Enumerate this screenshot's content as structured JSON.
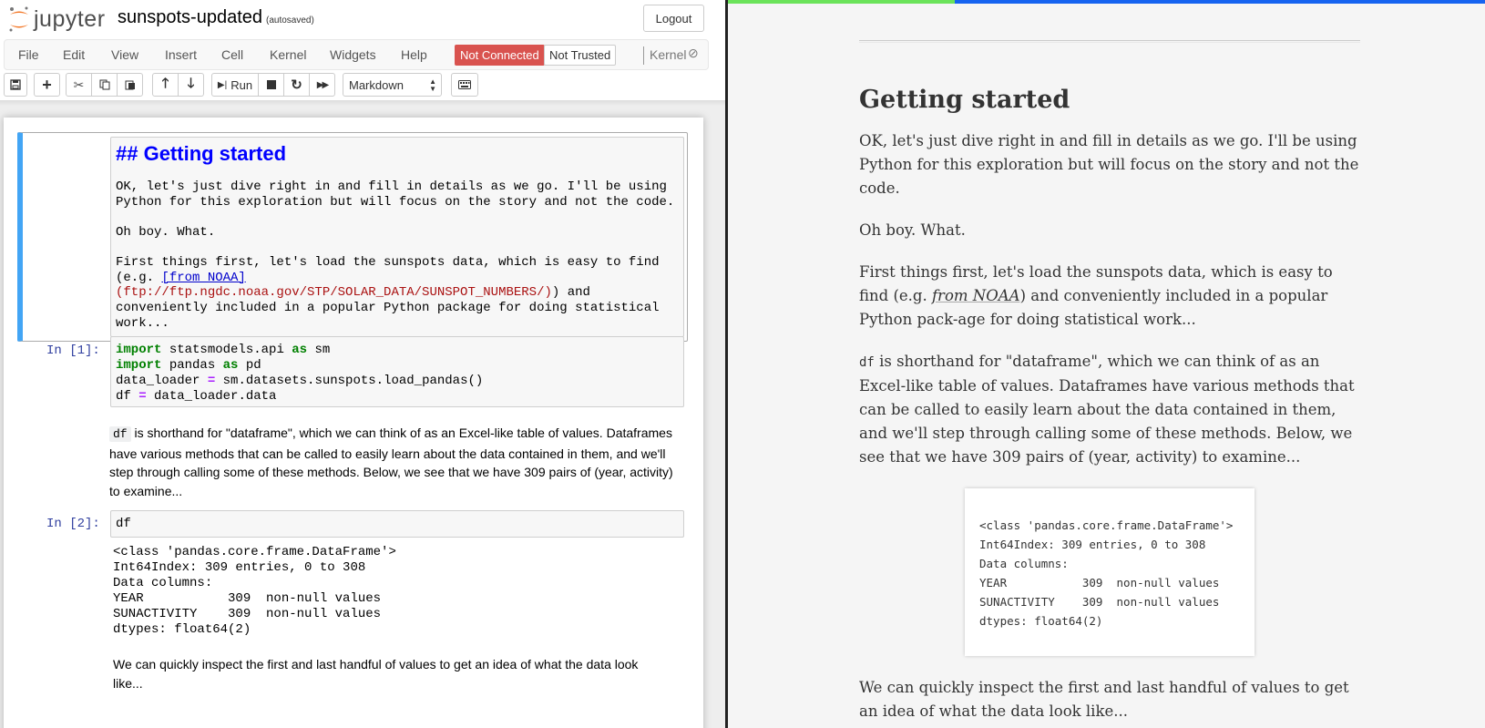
{
  "notebook": {
    "logo_text": "jupyter",
    "title": "sunspots-updated",
    "autosave": "(autosaved)",
    "logout_label": "Logout",
    "menu": [
      "File",
      "Edit",
      "View",
      "Insert",
      "Cell",
      "Kernel",
      "Widgets",
      "Help"
    ],
    "status_not_connected": "Not Connected",
    "status_not_trusted": "Not Trusted",
    "kernel_label": "Kernel",
    "toolbar": {
      "run_label": "Run",
      "cell_type": "Markdown"
    },
    "cells": {
      "md1": {
        "heading": "## Getting started",
        "lines": [
          "OK, let's just dive right in and fill in details as we go. I'll be using",
          "Python for this exploration but will focus on the story and not the code.",
          "",
          "Oh boy. What.",
          "",
          "First things first, let's load the sunspots data, which is easy to find"
        ],
        "line_eg": "(e.g. ",
        "link_text": "[from NOAA]",
        "url": "(ftp://ftp.ngdc.noaa.gov/STP/SOLAR_DATA/SUNSPOT_NUMBERS/)",
        "after_url": ") and",
        "tail_lines": [
          "conveniently included in a popular Python package for doing statistical",
          "work..."
        ]
      },
      "code1": {
        "prompt": "In [1]:",
        "kw_import": "import",
        "kw_as": "as",
        "op_eq": "=",
        "mod1": " statsmodels.api ",
        "alias1": " sm",
        "mod2": " pandas ",
        "alias2": " pd",
        "line3_left": "data_loader ",
        "line3_right": " sm.datasets.sunspots.load_pandas()",
        "line4_left": "df ",
        "line4_right": " data_loader.data"
      },
      "md2": {
        "code": "df",
        "text": " is shorthand for \"dataframe\", which we can think of as an Excel-like table of values. Dataframes have various methods that can be called to easily learn about the data contained in them, and we'll step through calling some of these methods. Below, we see that we have 309 pairs of (year, activity) to examine..."
      },
      "code2": {
        "prompt": "In [2]:",
        "source": "df",
        "output": [
          "<class 'pandas.core.frame.DataFrame'>",
          "Int64Index: 309 entries, 0 to 308",
          "Data columns:",
          "YEAR           309  non-null values",
          "SUNACTIVITY    309  non-null values",
          "dtypes: float64(2)"
        ]
      },
      "md3": {
        "text": "We can quickly inspect the first and last handful of values to get an idea of what the data look like..."
      }
    }
  },
  "preview": {
    "heading": "Getting started",
    "p1": "OK, let's just dive right in and fill in details as we go. I'll be using Python for this exploration but will focus on the story and not the code.",
    "p2": "Oh boy. What.",
    "p3_before": "First things first, let's load the sunspots data, which is easy to find (e.g. ",
    "p3_link": "from NOAA",
    "p3_after": ") and conveniently included in a popular Python pack-age for doing statistical work...",
    "p4_code": "df",
    "p4_text": " is shorthand for \"dataframe\", which we can think of as an Excel-like table of values. Dataframes have various methods that can be called to easily learn about the data contained in them, and we'll step through calling some of these methods. Below, we see that we have 309 pairs of (year, activity) to examine...",
    "output": [
      "<class 'pandas.core.frame.DataFrame'>",
      "Int64Index: 309 entries, 0 to 308",
      "Data columns:",
      "YEAR           309  non-null values",
      "SUNACTIVITY    309  non-null values",
      "dtypes: float64(2)"
    ],
    "p5": "We can quickly inspect the first and last handful of values to get an idea of what the data look like...",
    "scroll_progress": 0.3
  },
  "colors": {
    "selected_cell_border": "#42a5f5",
    "not_connected_badge": "#d9534f",
    "progress_green": "#6be35a",
    "progress_blue": "#1663f0",
    "markdown_heading": "#0000ff"
  }
}
